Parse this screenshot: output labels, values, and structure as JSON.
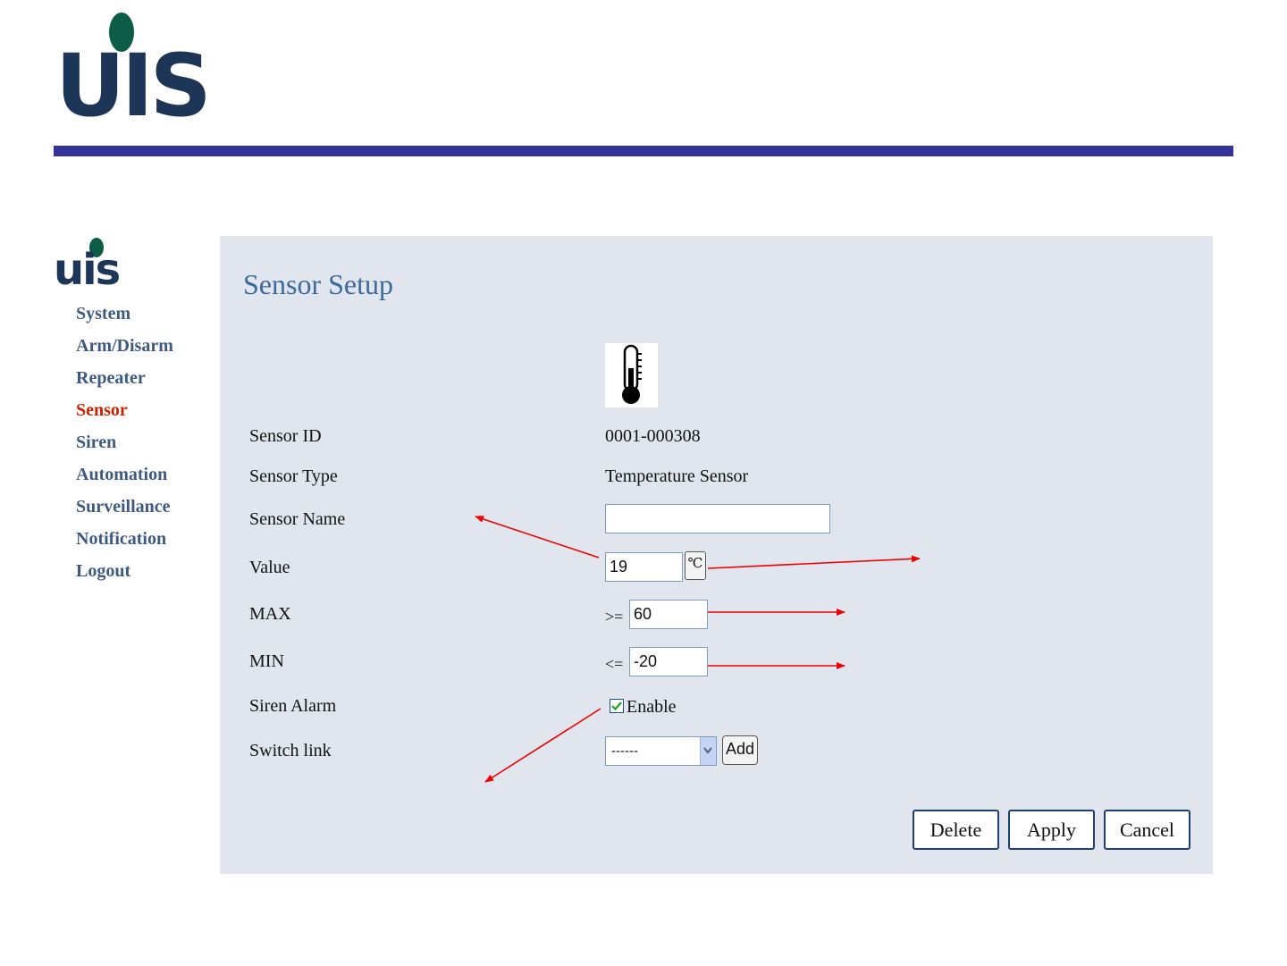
{
  "logo": {
    "text": "UIS",
    "small_text": "uis"
  },
  "nav": {
    "items": [
      {
        "label": "System"
      },
      {
        "label": "Arm/Disarm"
      },
      {
        "label": "Repeater"
      },
      {
        "label": "Sensor",
        "active": true
      },
      {
        "label": "Siren"
      },
      {
        "label": "Automation"
      },
      {
        "label": "Surveillance"
      },
      {
        "label": "Notification"
      },
      {
        "label": "Logout"
      }
    ]
  },
  "page": {
    "title": "Sensor Setup"
  },
  "sensor_icon": "thermometer-icon",
  "form": {
    "sensor_id": {
      "label": "Sensor ID",
      "value": "0001-000308"
    },
    "sensor_type": {
      "label": "Sensor Type",
      "value": "Temperature Sensor"
    },
    "sensor_name": {
      "label": "Sensor Name",
      "value": ""
    },
    "value": {
      "label": "Value",
      "value": "19",
      "unit": "℃"
    },
    "max": {
      "label": "MAX",
      "operator": ">=",
      "value": "60"
    },
    "min": {
      "label": "MIN",
      "operator": "<=",
      "value": "-20"
    },
    "siren_alarm": {
      "label": "Siren Alarm",
      "checked": true,
      "option": "Enable"
    },
    "switch_link": {
      "label": "Switch link",
      "selected": "------",
      "add_label": "Add"
    }
  },
  "buttons": {
    "delete": "Delete",
    "apply": "Apply",
    "cancel": "Cancel"
  },
  "colors": {
    "accent_bar": "#333399",
    "active_nav": "#cc2200",
    "nav": "#3d5a80",
    "panel": "#e1e6ee",
    "annotation_arrow": "#ee0000"
  }
}
